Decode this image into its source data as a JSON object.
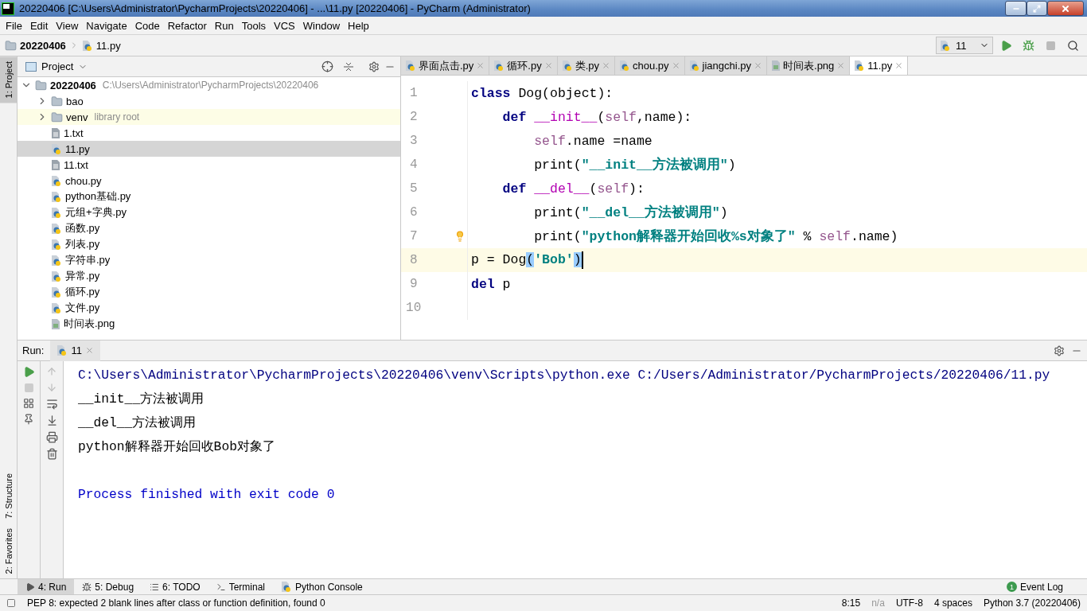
{
  "window": {
    "title": "20220406 [C:\\Users\\Administrator\\PycharmProjects\\20220406] - ...\\11.py [20220406] - PyCharm (Administrator)"
  },
  "menu": [
    "File",
    "Edit",
    "View",
    "Navigate",
    "Code",
    "Refactor",
    "Run",
    "Tools",
    "VCS",
    "Window",
    "Help"
  ],
  "breadcrumb": [
    {
      "label": "20220406",
      "kind": "folder"
    },
    {
      "label": "11.py",
      "kind": "py"
    }
  ],
  "run_config": {
    "label": "11"
  },
  "tool_strip": [
    {
      "label": "1: Project",
      "kind": "top",
      "selected": true
    },
    {
      "label": "7: Structure",
      "kind": "bottom",
      "selected": false
    },
    {
      "label": "2: Favorites",
      "kind": "bottom",
      "selected": false
    }
  ],
  "project": {
    "title": "Project",
    "tree": [
      {
        "label": "20220406",
        "hint": "C:\\Users\\Administrator\\PycharmProjects\\20220406",
        "kind": "root",
        "expanded": true,
        "selected": false,
        "children": [
          {
            "label": "bao",
            "kind": "folder",
            "expanded": false,
            "selected": false
          },
          {
            "label": "venv",
            "hint": "library root",
            "kind": "library",
            "expanded": false,
            "selected": false
          },
          {
            "label": "1.txt",
            "kind": "txt",
            "selected": false
          },
          {
            "label": "11.py",
            "kind": "py",
            "selected": true
          },
          {
            "label": "11.txt",
            "kind": "txt",
            "selected": false
          },
          {
            "label": "chou.py",
            "kind": "py",
            "selected": false
          },
          {
            "label": "python基础.py",
            "kind": "py",
            "selected": false
          },
          {
            "label": "元组+字典.py",
            "kind": "py",
            "selected": false
          },
          {
            "label": "函数.py",
            "kind": "py",
            "selected": false
          },
          {
            "label": "列表.py",
            "kind": "py",
            "selected": false
          },
          {
            "label": "字符串.py",
            "kind": "py",
            "selected": false
          },
          {
            "label": "异常.py",
            "kind": "py",
            "selected": false
          },
          {
            "label": "循环.py",
            "kind": "py",
            "selected": false
          },
          {
            "label": "文件.py",
            "kind": "py",
            "selected": false
          },
          {
            "label": "时间表.png",
            "kind": "png",
            "selected": false
          }
        ]
      }
    ]
  },
  "editor_tabs": [
    {
      "label": "界面点击.py",
      "kind": "py",
      "selected": false
    },
    {
      "label": "循环.py",
      "kind": "py",
      "selected": false
    },
    {
      "label": "类.py",
      "kind": "py",
      "selected": false
    },
    {
      "label": "chou.py",
      "kind": "py",
      "selected": false
    },
    {
      "label": "jiangchi.py",
      "kind": "py",
      "selected": false
    },
    {
      "label": "时间表.png",
      "kind": "png",
      "selected": false
    },
    {
      "label": "11.py",
      "kind": "py",
      "selected": true
    }
  ],
  "code": [
    {
      "number": "1",
      "current": false,
      "bulb": false,
      "tokens": [
        {
          "text": "class",
          "kind": "keyword"
        },
        {
          "text": " Dog(object):",
          "kind": "plain"
        }
      ]
    },
    {
      "number": "2",
      "current": false,
      "bulb": false,
      "tokens": [
        {
          "text": "    def",
          "kind": "keyword"
        },
        {
          "text": " __init__",
          "kind": "magic"
        },
        {
          "text": "(",
          "kind": "plain"
        },
        {
          "text": "self",
          "kind": "self"
        },
        {
          "text": ",name):",
          "kind": "plain"
        }
      ]
    },
    {
      "number": "3",
      "current": false,
      "bulb": false,
      "tokens": [
        {
          "text": "        self",
          "kind": "self"
        },
        {
          "text": ".name =name",
          "kind": "plain"
        }
      ]
    },
    {
      "number": "4",
      "current": false,
      "bulb": false,
      "tokens": [
        {
          "text": "        print(",
          "kind": "plain"
        },
        {
          "text": "\"__init__方法被调用\"",
          "kind": "string"
        },
        {
          "text": ")",
          "kind": "plain"
        }
      ]
    },
    {
      "number": "5",
      "current": false,
      "bulb": false,
      "tokens": [
        {
          "text": "    def",
          "kind": "keyword"
        },
        {
          "text": " __del__",
          "kind": "magic"
        },
        {
          "text": "(",
          "kind": "plain"
        },
        {
          "text": "self",
          "kind": "self"
        },
        {
          "text": "):",
          "kind": "plain"
        }
      ]
    },
    {
      "number": "6",
      "current": false,
      "bulb": false,
      "tokens": [
        {
          "text": "        print(",
          "kind": "plain"
        },
        {
          "text": "\"__del__方法被调用\"",
          "kind": "string"
        },
        {
          "text": ")",
          "kind": "plain"
        }
      ]
    },
    {
      "number": "7",
      "current": false,
      "bulb": true,
      "tokens": [
        {
          "text": "        print(",
          "kind": "plain"
        },
        {
          "text": "\"python解释器开始回收%s对象了\"",
          "kind": "string"
        },
        {
          "text": " % ",
          "kind": "plain"
        },
        {
          "text": "self",
          "kind": "self"
        },
        {
          "text": ".name)",
          "kind": "plain"
        }
      ]
    },
    {
      "number": "8",
      "current": true,
      "bulb": false,
      "tokens": [
        {
          "text": "p = Dog",
          "kind": "plain"
        },
        {
          "text": "(",
          "kind": "brace"
        },
        {
          "text": "'Bob'",
          "kind": "string"
        },
        {
          "text": ")",
          "kind": "brace"
        }
      ]
    },
    {
      "number": "9",
      "current": false,
      "bulb": false,
      "tokens": [
        {
          "text": "del",
          "kind": "keyword"
        },
        {
          "text": " p",
          "kind": "plain"
        }
      ]
    },
    {
      "number": "10",
      "current": false,
      "bulb": false
    }
  ],
  "run": {
    "title": "Run:",
    "tab": "11",
    "console": [
      {
        "text": "C:\\Users\\Administrator\\PycharmProjects\\20220406\\venv\\Scripts\\python.exe C:/Users/Administrator/PycharmProjects/20220406/11.py",
        "kind": "command"
      },
      {
        "text": "__init__方法被调用",
        "kind": "output"
      },
      {
        "text": "__del__方法被调用",
        "kind": "output"
      },
      {
        "text": "python解释器开始回收Bob对象了",
        "kind": "output"
      },
      {
        "kind": "blank"
      },
      {
        "text": "Process finished with exit code 0",
        "kind": "exit"
      }
    ]
  },
  "bottom_tabs": [
    {
      "label": "4: Run",
      "kind": "run",
      "selected": true
    },
    {
      "label": "5: Debug",
      "kind": "debug",
      "selected": false
    },
    {
      "label": "6: TODO",
      "kind": "todo",
      "selected": false
    },
    {
      "label": "Terminal",
      "kind": "terminal",
      "selected": false
    },
    {
      "label": "Python Console",
      "kind": "console",
      "selected": false
    }
  ],
  "event_log": {
    "label": "Event Log",
    "count": "1"
  },
  "status_bar": {
    "message": "PEP 8: expected 2 blank lines after class or function definition, found 0",
    "items": [
      {
        "text": "8:15",
        "kind": "plain"
      },
      {
        "text": "n/a",
        "kind": "muted"
      },
      {
        "text": "UTF-8",
        "kind": "menu"
      },
      {
        "text": "4 spaces",
        "kind": "menu"
      },
      {
        "text": "Python 3.7 (20220406)",
        "kind": "menu"
      }
    ]
  }
}
